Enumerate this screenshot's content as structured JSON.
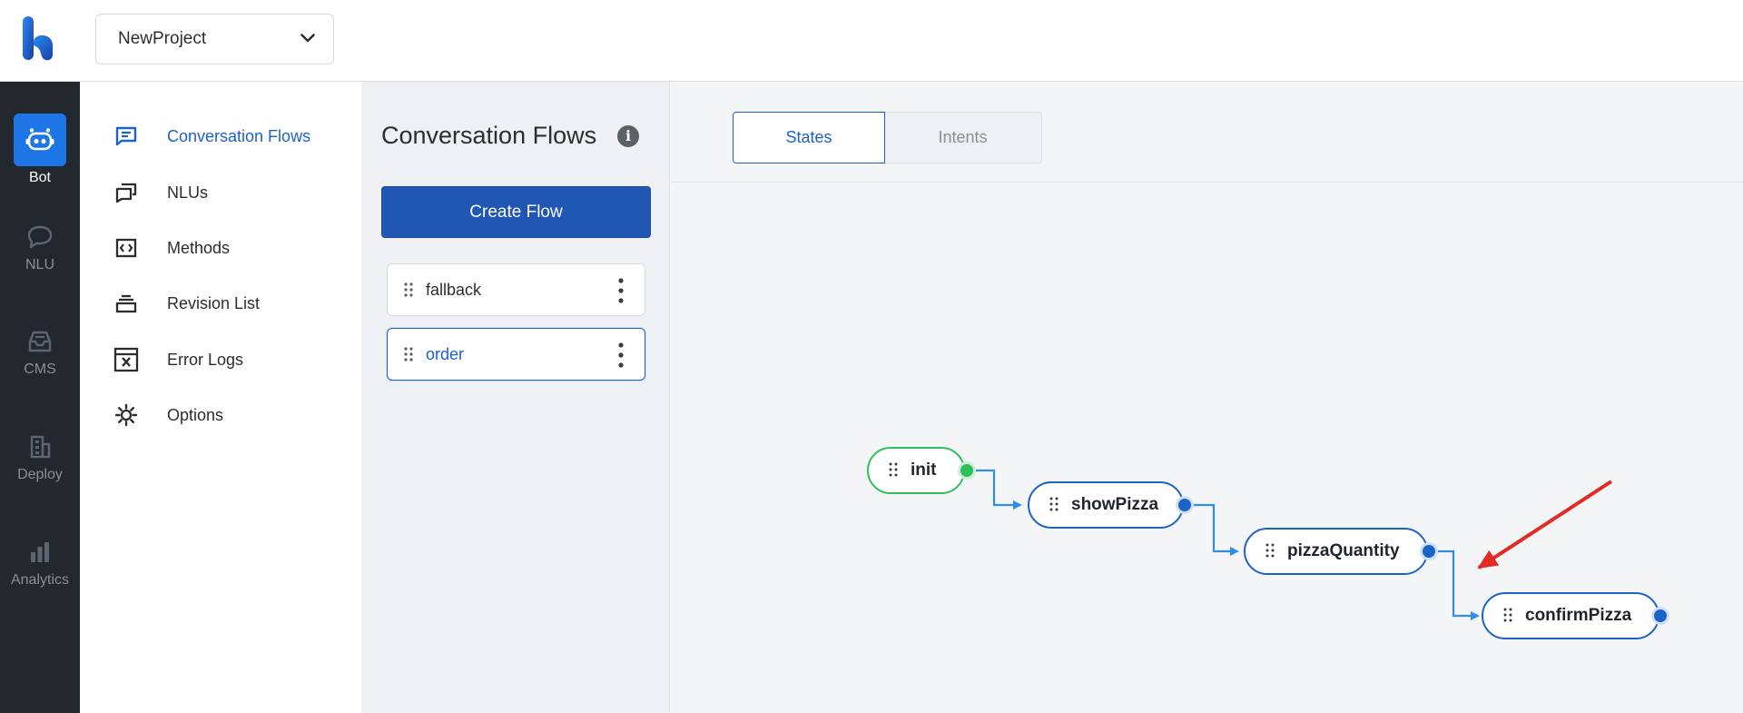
{
  "header": {
    "project_name": "NewProject",
    "chevron_icon": "chevron-down-icon"
  },
  "dark_sidebar": {
    "items": [
      {
        "label": "Bot",
        "icon": "bot-icon",
        "active": true
      },
      {
        "label": "NLU",
        "icon": "chat-bubble-icon",
        "active": false
      },
      {
        "label": "CMS",
        "icon": "inbox-icon",
        "active": false
      },
      {
        "label": "Deploy",
        "icon": "building-icon",
        "active": false
      },
      {
        "label": "Analytics",
        "icon": "bar-chart-icon",
        "active": false
      }
    ]
  },
  "bot_nav": {
    "items": [
      {
        "label": "Conversation Flows",
        "icon": "message-square-icon",
        "active": true
      },
      {
        "label": "NLUs",
        "icon": "messages-icon",
        "active": false
      },
      {
        "label": "Methods",
        "icon": "code-icon",
        "active": false
      },
      {
        "label": "Revision List",
        "icon": "layers-icon",
        "active": false
      },
      {
        "label": "Error Logs",
        "icon": "error-log-icon",
        "active": false
      },
      {
        "label": "Options",
        "icon": "gear-icon",
        "active": false
      }
    ]
  },
  "flows_panel": {
    "title": "Conversation Flows",
    "info_icon": "i",
    "create_button": "Create Flow",
    "flows": [
      {
        "name": "fallback",
        "selected": false
      },
      {
        "name": "order",
        "selected": true
      }
    ]
  },
  "canvas": {
    "tabs": [
      {
        "label": "States",
        "active": true
      },
      {
        "label": "Intents",
        "active": false
      }
    ],
    "states": [
      {
        "name": "init",
        "type": "initial"
      },
      {
        "name": "showPizza",
        "type": "state"
      },
      {
        "name": "pizzaQuantity",
        "type": "state"
      },
      {
        "name": "confirmPizza",
        "type": "state"
      }
    ]
  },
  "colors": {
    "accent": "#1d62c7",
    "button": "#2157b4",
    "init_green": "#2fbf5a",
    "annotation_arrow": "#e32b25",
    "dark_sidebar": "#23272e"
  }
}
